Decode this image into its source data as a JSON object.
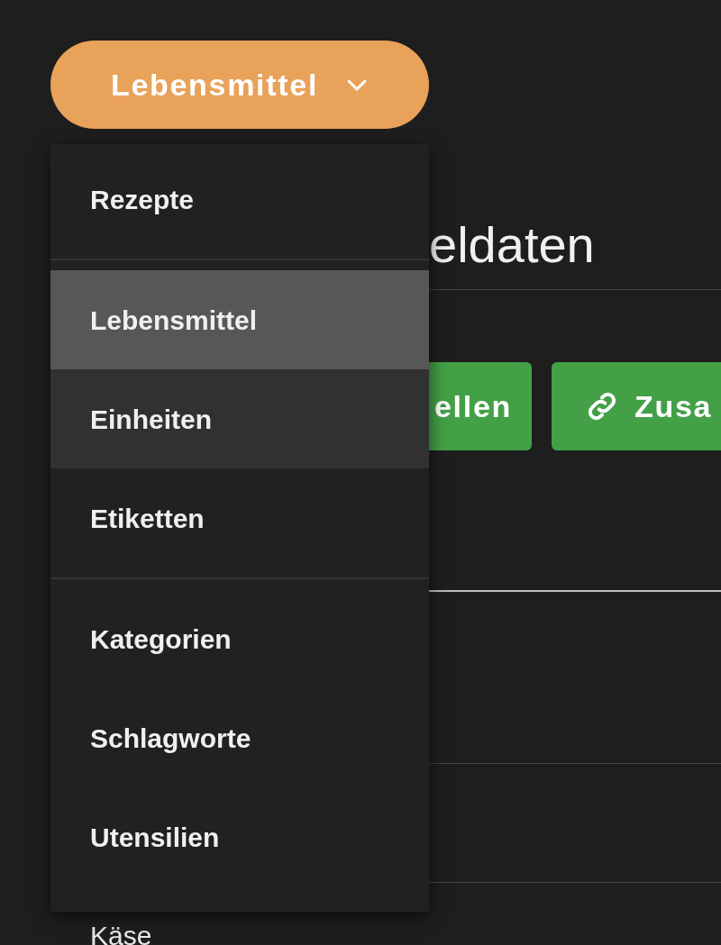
{
  "dropdown": {
    "label": "Lebensmittel",
    "expanded": true
  },
  "menu": {
    "groups": [
      [
        {
          "label": "Rezepte",
          "selected": false,
          "hovered": false
        }
      ],
      [
        {
          "label": "Lebensmittel",
          "selected": true,
          "hovered": false
        },
        {
          "label": "Einheiten",
          "selected": false,
          "hovered": true
        },
        {
          "label": "Etiketten",
          "selected": false,
          "hovered": false
        }
      ],
      [
        {
          "label": "Kategorien",
          "selected": false,
          "hovered": false
        },
        {
          "label": "Schlagworte",
          "selected": false,
          "hovered": false
        },
        {
          "label": "Utensilien",
          "selected": false,
          "hovered": false
        }
      ]
    ]
  },
  "page": {
    "heading": "eldaten",
    "buttons": [
      {
        "label": "ellen",
        "kind": "plain"
      },
      {
        "label": "Zusa",
        "kind": "link"
      }
    ],
    "rows": [
      "Käse"
    ]
  }
}
